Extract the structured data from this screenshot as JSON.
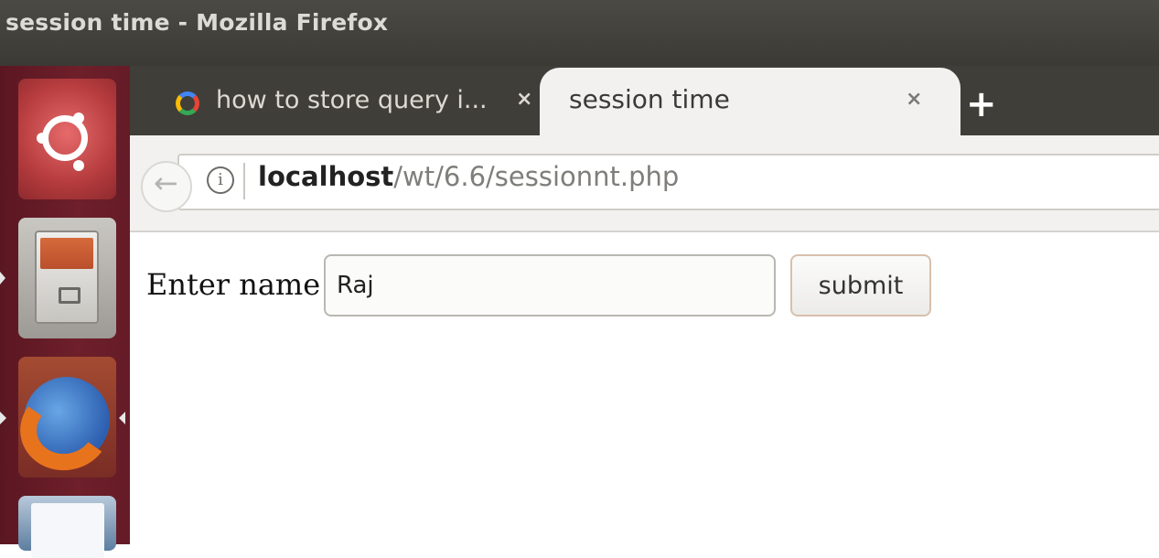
{
  "window": {
    "title": "session time - Mozilla Firefox"
  },
  "tabs": [
    {
      "label": "how to store query i...",
      "icon": "google-icon",
      "active": false
    },
    {
      "label": "session time",
      "active": true
    }
  ],
  "new_tab_label": "+",
  "close_glyph": "×",
  "address_bar": {
    "host": "localhost",
    "path": "/wt/6.6/sessionnt.php",
    "info_glyph": "i"
  },
  "launcher": {
    "items": [
      "ubuntu-dash-icon",
      "files-icon",
      "firefox-icon",
      "writer-icon"
    ]
  },
  "form": {
    "label": "Enter name",
    "name_value": "Raj",
    "submit_label": "submit"
  },
  "colors": {
    "title_bar": "#3f3e39",
    "launcher": "#6e1f2a",
    "active_tab": "#f2f1ef"
  }
}
